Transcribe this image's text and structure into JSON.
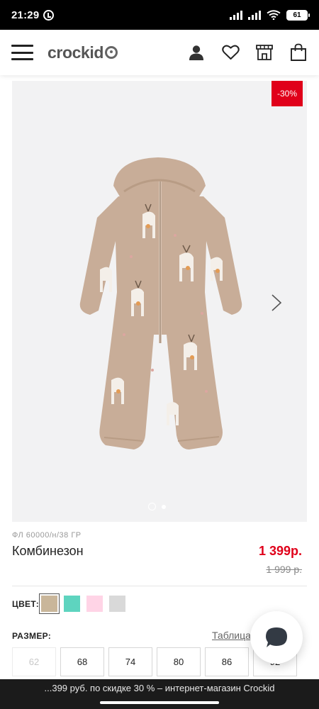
{
  "status_bar": {
    "time": "21:29",
    "battery": "61",
    "icons": [
      "alarm-icon",
      "signal-icon",
      "signal-icon",
      "wifi-icon",
      "battery-icon"
    ]
  },
  "header": {
    "logo": "crockid",
    "icons": [
      "menu-icon",
      "user-icon",
      "heart-icon",
      "store-icon",
      "bag-icon"
    ]
  },
  "gallery": {
    "discount_badge": "-30%",
    "slide_count": 2,
    "active_slide": 1
  },
  "product": {
    "sku": "ФЛ 60000/н/38 ГР",
    "title": "Комбинезон",
    "price_new": "1 399р.",
    "price_old": "1 999 р."
  },
  "color": {
    "label": "ЦВЕТ:",
    "swatches": [
      {
        "hex": "#c9b69a",
        "selected": true
      },
      {
        "hex": "#5ed4bf",
        "selected": false
      },
      {
        "hex": "#ffd4e6",
        "selected": false
      },
      {
        "hex": "#d9d9d9",
        "selected": false
      }
    ]
  },
  "size": {
    "label": "РАЗМЕР:",
    "table_link": "Таблица",
    "options": [
      {
        "label": "62",
        "available": false
      },
      {
        "label": "68",
        "available": true
      },
      {
        "label": "74",
        "available": true
      },
      {
        "label": "80",
        "available": true
      },
      {
        "label": "86",
        "available": true
      },
      {
        "label": "92",
        "available": true
      }
    ]
  },
  "bottom_bar": {
    "text": "...399 руб. по скидке 30 % – интернет-магазин Crockid"
  },
  "colors": {
    "accent": "#e0001a",
    "fabric": "#c8ad98"
  }
}
